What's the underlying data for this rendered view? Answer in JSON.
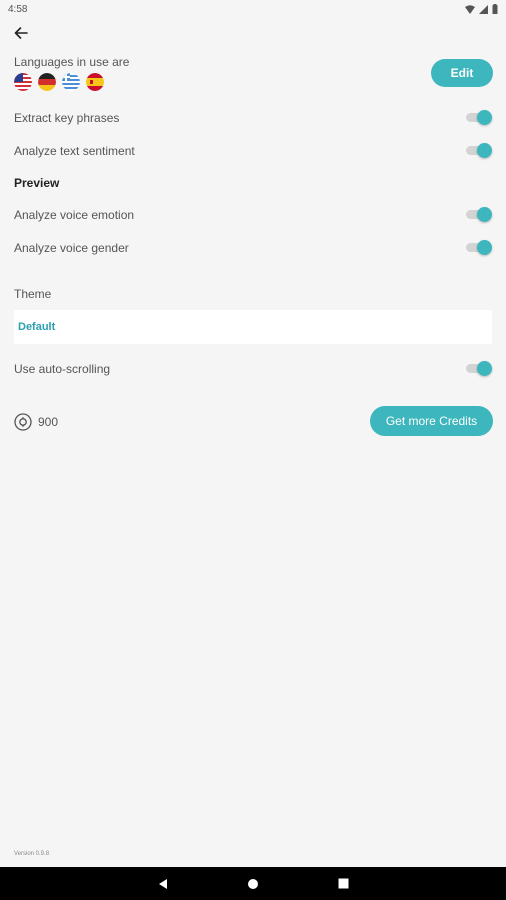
{
  "status_bar": {
    "time": "4:58"
  },
  "languages": {
    "label": "Languages in use are",
    "flags": [
      "us-flag-icon",
      "germany-flag-icon",
      "greece-flag-icon",
      "spain-flag-icon"
    ],
    "edit_label": "Edit"
  },
  "settings": {
    "extract_key_phrases": {
      "label": "Extract key phrases",
      "on": true
    },
    "analyze_text_sentiment": {
      "label": "Analyze text sentiment",
      "on": true
    },
    "preview_title": "Preview",
    "analyze_voice_emotion": {
      "label": "Analyze voice emotion",
      "on": true
    },
    "analyze_voice_gender": {
      "label": "Analyze voice gender",
      "on": true
    },
    "theme_label": "Theme",
    "theme_value": "Default",
    "auto_scrolling": {
      "label": "Use auto-scrolling",
      "on": true
    }
  },
  "credits": {
    "count": "900",
    "button_label": "Get more Credits"
  },
  "footer": {
    "version": "Version 0.9.8"
  },
  "colors": {
    "accent": "#3db6bd",
    "background": "#f5f5f5",
    "track": "#d3d3d3"
  }
}
